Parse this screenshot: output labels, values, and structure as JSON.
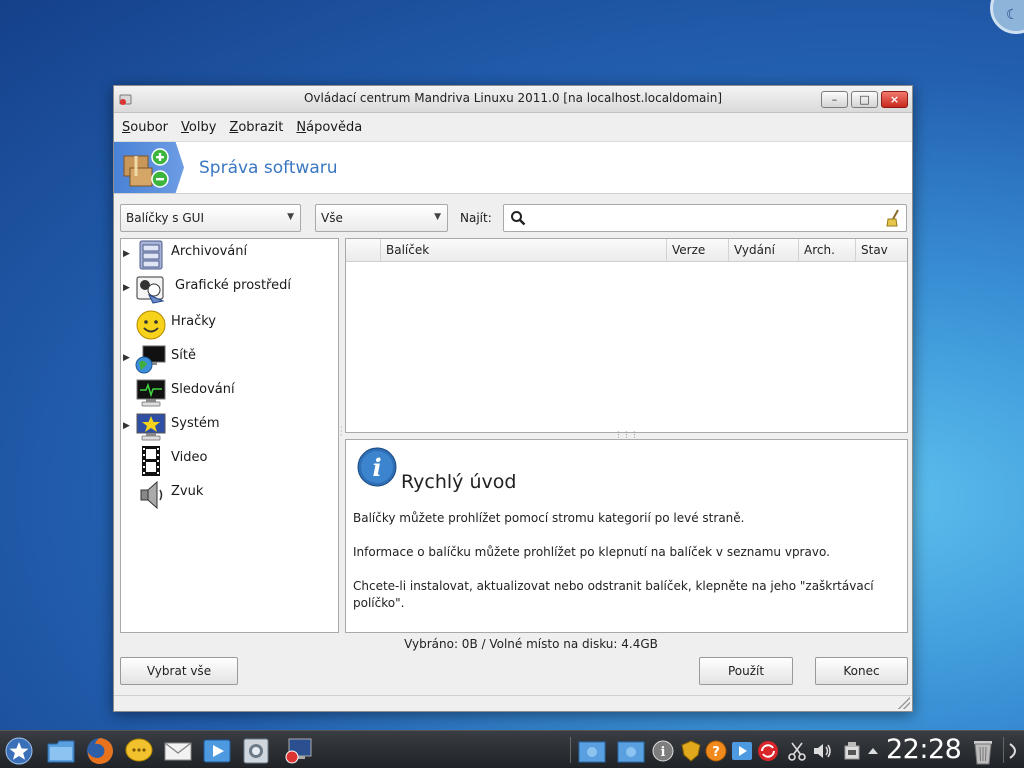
{
  "window": {
    "title": "Ovládací centrum Mandriva Linuxu 2011.0 [na localhost.localdomain]",
    "buttons": {
      "minimize": "–",
      "maximize": "□",
      "close": "×"
    }
  },
  "menu": [
    {
      "label_u": "S",
      "label_rest": "oubor"
    },
    {
      "label_u": "V",
      "label_rest": "olby"
    },
    {
      "label_u": "Z",
      "label_rest": "obrazit"
    },
    {
      "label_u": "N",
      "label_rest": "ápověda"
    }
  ],
  "banner": {
    "title": "Správa softwaru",
    "icon": "package-add-remove-icon"
  },
  "filters": {
    "type_combo": "Balíčky s GUI",
    "status_combo": "Vše",
    "find_label": "Najít:",
    "search_value": "",
    "search_placeholder": ""
  },
  "categories": [
    {
      "label": "Archivování",
      "icon": "archive-cabinet-icon",
      "expandable": true
    },
    {
      "label": "Grafické prostředí",
      "icon": "graphical-desktop-icon",
      "expandable": true
    },
    {
      "label": "Hračky",
      "icon": "smiley-toy-icon",
      "expandable": false
    },
    {
      "label": "Sítě",
      "icon": "network-globe-icon",
      "expandable": true
    },
    {
      "label": "Sledování",
      "icon": "monitoring-icon",
      "expandable": false
    },
    {
      "label": "Systém",
      "icon": "system-icon",
      "expandable": true
    },
    {
      "label": "Video",
      "icon": "film-strip-icon",
      "expandable": false
    },
    {
      "label": "Zvuk",
      "icon": "speaker-icon",
      "expandable": false
    }
  ],
  "table": {
    "columns": [
      "",
      "Balíček",
      "Verze",
      "Vydání",
      "Arch.",
      "Stav"
    ],
    "rows": []
  },
  "info": {
    "title": "Rychlý úvod",
    "paragraphs": [
      "Balíčky můžete prohlížet pomocí stromu kategorií po levé straně.",
      "Informace o balíčku můžete prohlížet po klepnutí na balíček v seznamu vpravo.",
      "Chcete-li instalovat, aktualizovat nebo odstranit balíček, klepněte na jeho \"zaškrtávací políčko\"."
    ]
  },
  "status": "Vybráno: 0B / Volné místo na disku: 4.4GB",
  "buttons": {
    "select_all": "Vybrat vše",
    "apply": "Použít",
    "quit": "Konec"
  },
  "taskbar": {
    "clock": "22:28"
  },
  "colors": {
    "accent": "#3a77c2",
    "banner_icon_bg": "#4a82d6",
    "close_button": "#c8281c"
  }
}
